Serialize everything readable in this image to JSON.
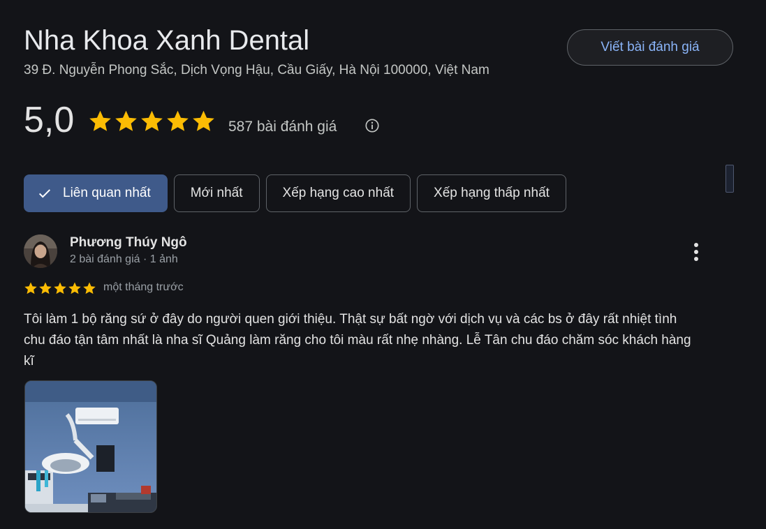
{
  "place": {
    "name": "Nha Khoa Xanh Dental",
    "address": "39 Đ. Nguyễn Phong Sắc, Dịch Vọng Hậu, Cầu Giấy, Hà Nội 100000, Việt Nam",
    "write_review_label": "Viết bài đánh giá"
  },
  "summary": {
    "rating": "5,0",
    "stars": 5,
    "review_count": "587 bài đánh giá",
    "info_icon": "info-icon"
  },
  "sort_chips": [
    {
      "label": "Liên quan nhất",
      "active": true,
      "icon": "check-icon"
    },
    {
      "label": "Mới nhất",
      "active": false
    },
    {
      "label": "Xếp hạng cao nhất",
      "active": false
    },
    {
      "label": "Xếp hạng thấp nhất",
      "active": false
    }
  ],
  "review": {
    "author": "Phương Thúy Ngô",
    "meta": "2 bài đánh giá · 1 ảnh",
    "stars": 5,
    "time": "một tháng trước",
    "text": "Tôi làm 1 bộ răng sứ ở đây do người quen giới thiệu. Thật sự bất ngờ với dịch vụ và các bs ở đây rất nhiệt tình chu đáo tận tâm nhất là nha sĩ Quảng làm răng cho tôi màu rất nhẹ nhàng. Lễ Tân chu đáo chăm sóc khách hàng kĩ",
    "more_icon": "more-vert-icon",
    "photo": "dental-office-photo"
  },
  "colors": {
    "background": "#131418",
    "star": "#fbbc04",
    "accent_link": "#8ab4f8",
    "active_chip": "#3f5a8a"
  }
}
